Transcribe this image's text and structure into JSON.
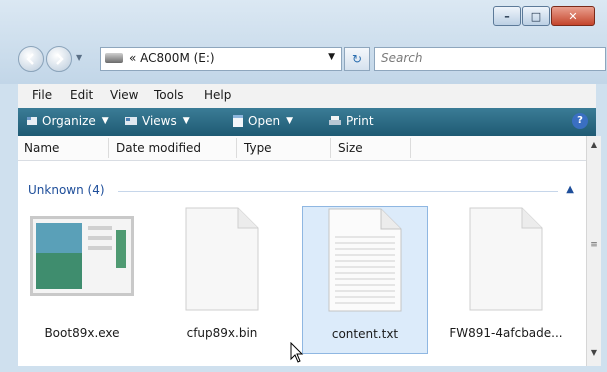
{
  "window": {
    "controls": {
      "minimize": "–",
      "maximize": "□",
      "close": "✕"
    }
  },
  "nav": {
    "address": "« AC800M (E:)",
    "search_placeholder": "Search"
  },
  "menu": [
    "File",
    "Edit",
    "View",
    "Tools",
    "Help"
  ],
  "toolbar": {
    "organize": "Organize",
    "views": "Views",
    "open": "Open",
    "print": "Print",
    "help": "?"
  },
  "columns": [
    "Name",
    "Date modified",
    "Type",
    "Size"
  ],
  "group": {
    "label": "Unknown (4)"
  },
  "files": [
    {
      "name": "Boot89x.exe",
      "icon": "app-window-icon"
    },
    {
      "name": "cfup89x.bin",
      "icon": "blank-file-icon"
    },
    {
      "name": "content.txt",
      "icon": "text-file-icon",
      "selected": true
    },
    {
      "name": "FW891-4afcbade...",
      "icon": "blank-file-icon"
    }
  ]
}
